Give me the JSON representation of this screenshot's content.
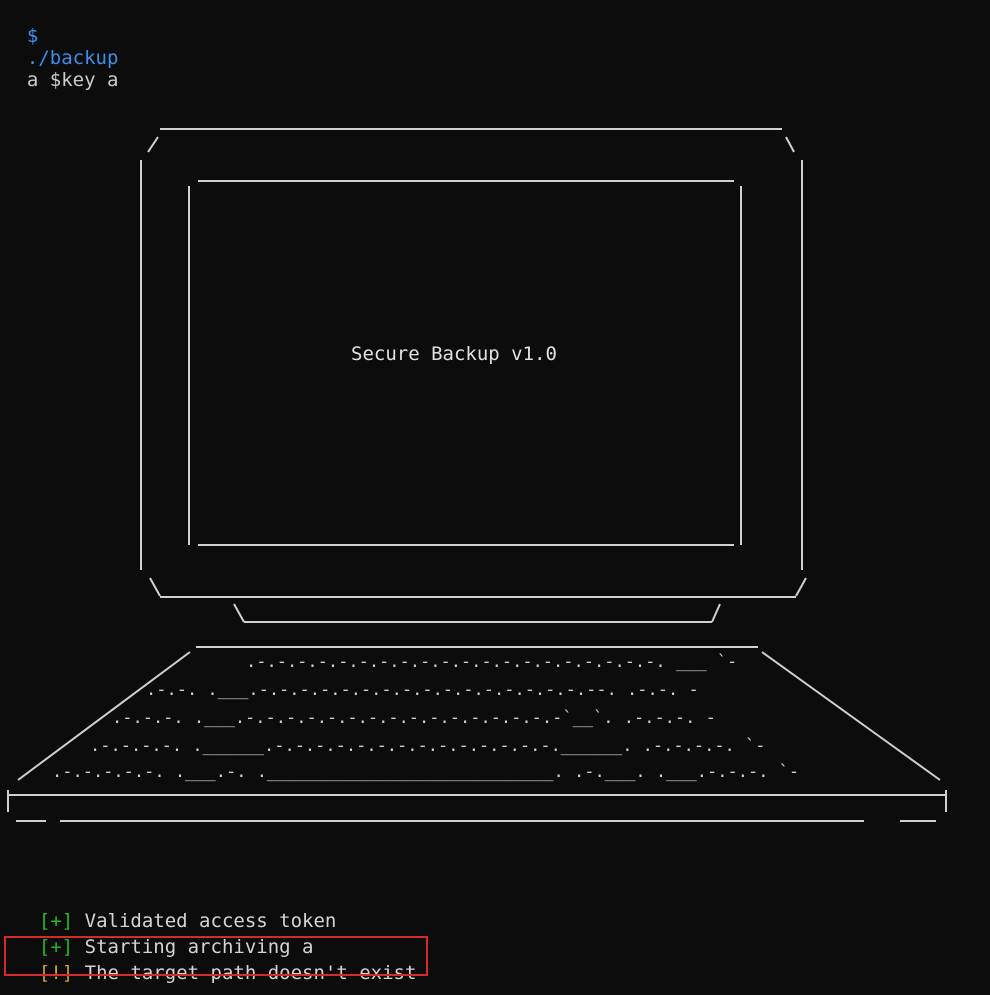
{
  "prompt": {
    "symbol": "$",
    "command": "./backup",
    "args": "a $key a"
  },
  "screen": {
    "title": "Secure Backup v1.0"
  },
  "keyboard_rows": [
    ".-.-.-.-.-.-.-.-.-.-.-.-.-.-.-.-.-.-.-.-.  ___  `-",
    ".-.-. .___.-.-.-.-.-.-.-.-.-.-.-.-.-.-.-.-.--.  .-.-. -",
    ".-.-.-. .___.-.-.-.-.-.-.-.-.-.-.-.-.-.-.-.-`__`. .-.-.-. -",
    ".-.-.-.-. .______.-.-.-.-.-.-.-.-.-.-.-.-.-.-.______. .-.-.-.-. `-",
    ".-.-.-.-.-. .___.-. .____________________________. .-.___. .___.-.-.-. `-"
  ],
  "log": [
    {
      "tag": "[+]",
      "level": "ok",
      "text": "Validated access token"
    },
    {
      "tag": "[+]",
      "level": "ok",
      "text": "Starting archiving a"
    },
    {
      "tag": "[!]",
      "level": "warn",
      "text": "The target path doesn't exist"
    }
  ],
  "colors": {
    "prompt": "#3b8eea",
    "ok": "#23b723",
    "warn": "#c8a028",
    "highlight": "#d42a2a",
    "background": "#0c0c0c"
  }
}
